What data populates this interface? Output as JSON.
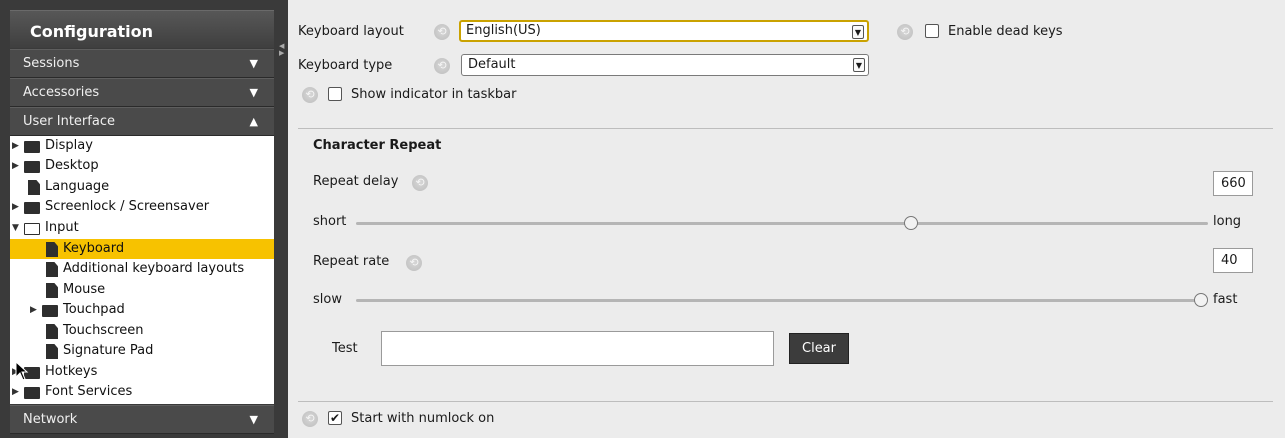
{
  "sidebar": {
    "header": "Configuration",
    "categories": [
      {
        "label": "Sessions",
        "arrow": "▼"
      },
      {
        "label": "Accessories",
        "arrow": "▼"
      },
      {
        "label": "User Interface",
        "arrow": "▲"
      },
      {
        "label": "Network",
        "arrow": "▼"
      }
    ],
    "tree": [
      {
        "label": "Display"
      },
      {
        "label": "Desktop"
      },
      {
        "label": "Language"
      },
      {
        "label": "Screenlock / Screensaver"
      },
      {
        "label": "Input"
      },
      {
        "label": "Keyboard"
      },
      {
        "label": "Additional keyboard layouts"
      },
      {
        "label": "Mouse"
      },
      {
        "label": "Touchpad"
      },
      {
        "label": "Touchscreen"
      },
      {
        "label": "Signature Pad"
      },
      {
        "label": "Hotkeys"
      },
      {
        "label": "Font Services"
      }
    ],
    "selected": "Keyboard"
  },
  "keyboard": {
    "layout_label": "Keyboard layout",
    "layout_value": "English(US)",
    "dead_keys_label": "Enable dead keys",
    "dead_keys_checked": false,
    "type_label": "Keyboard type",
    "type_value": "Default",
    "indicator_label": "Show indicator in taskbar",
    "indicator_checked": false
  },
  "repeat": {
    "title": "Character Repeat",
    "delay_label": "Repeat delay",
    "delay_value": "660",
    "delay_min_label": "short",
    "delay_max_label": "long",
    "delay_slider_fraction": 0.66,
    "rate_label": "Repeat rate",
    "rate_value": "40",
    "rate_min_label": "slow",
    "rate_max_label": "fast",
    "rate_slider_fraction": 1.0,
    "test_label": "Test",
    "test_value": "",
    "clear_label": "Clear"
  },
  "numlock": {
    "label": "Start with numlock on",
    "checked": true
  },
  "colors": {
    "selection": "#f7c200",
    "focus_border": "#caa200",
    "sidebar_bg": "#3a3a3a",
    "panel_bg": "#ececec"
  },
  "icons": [
    "folder-icon",
    "folder-open-icon",
    "document-icon",
    "reset-icon",
    "expand-arrow-icon",
    "dropdown-arrow-icon",
    "mouse-cursor-icon"
  ]
}
